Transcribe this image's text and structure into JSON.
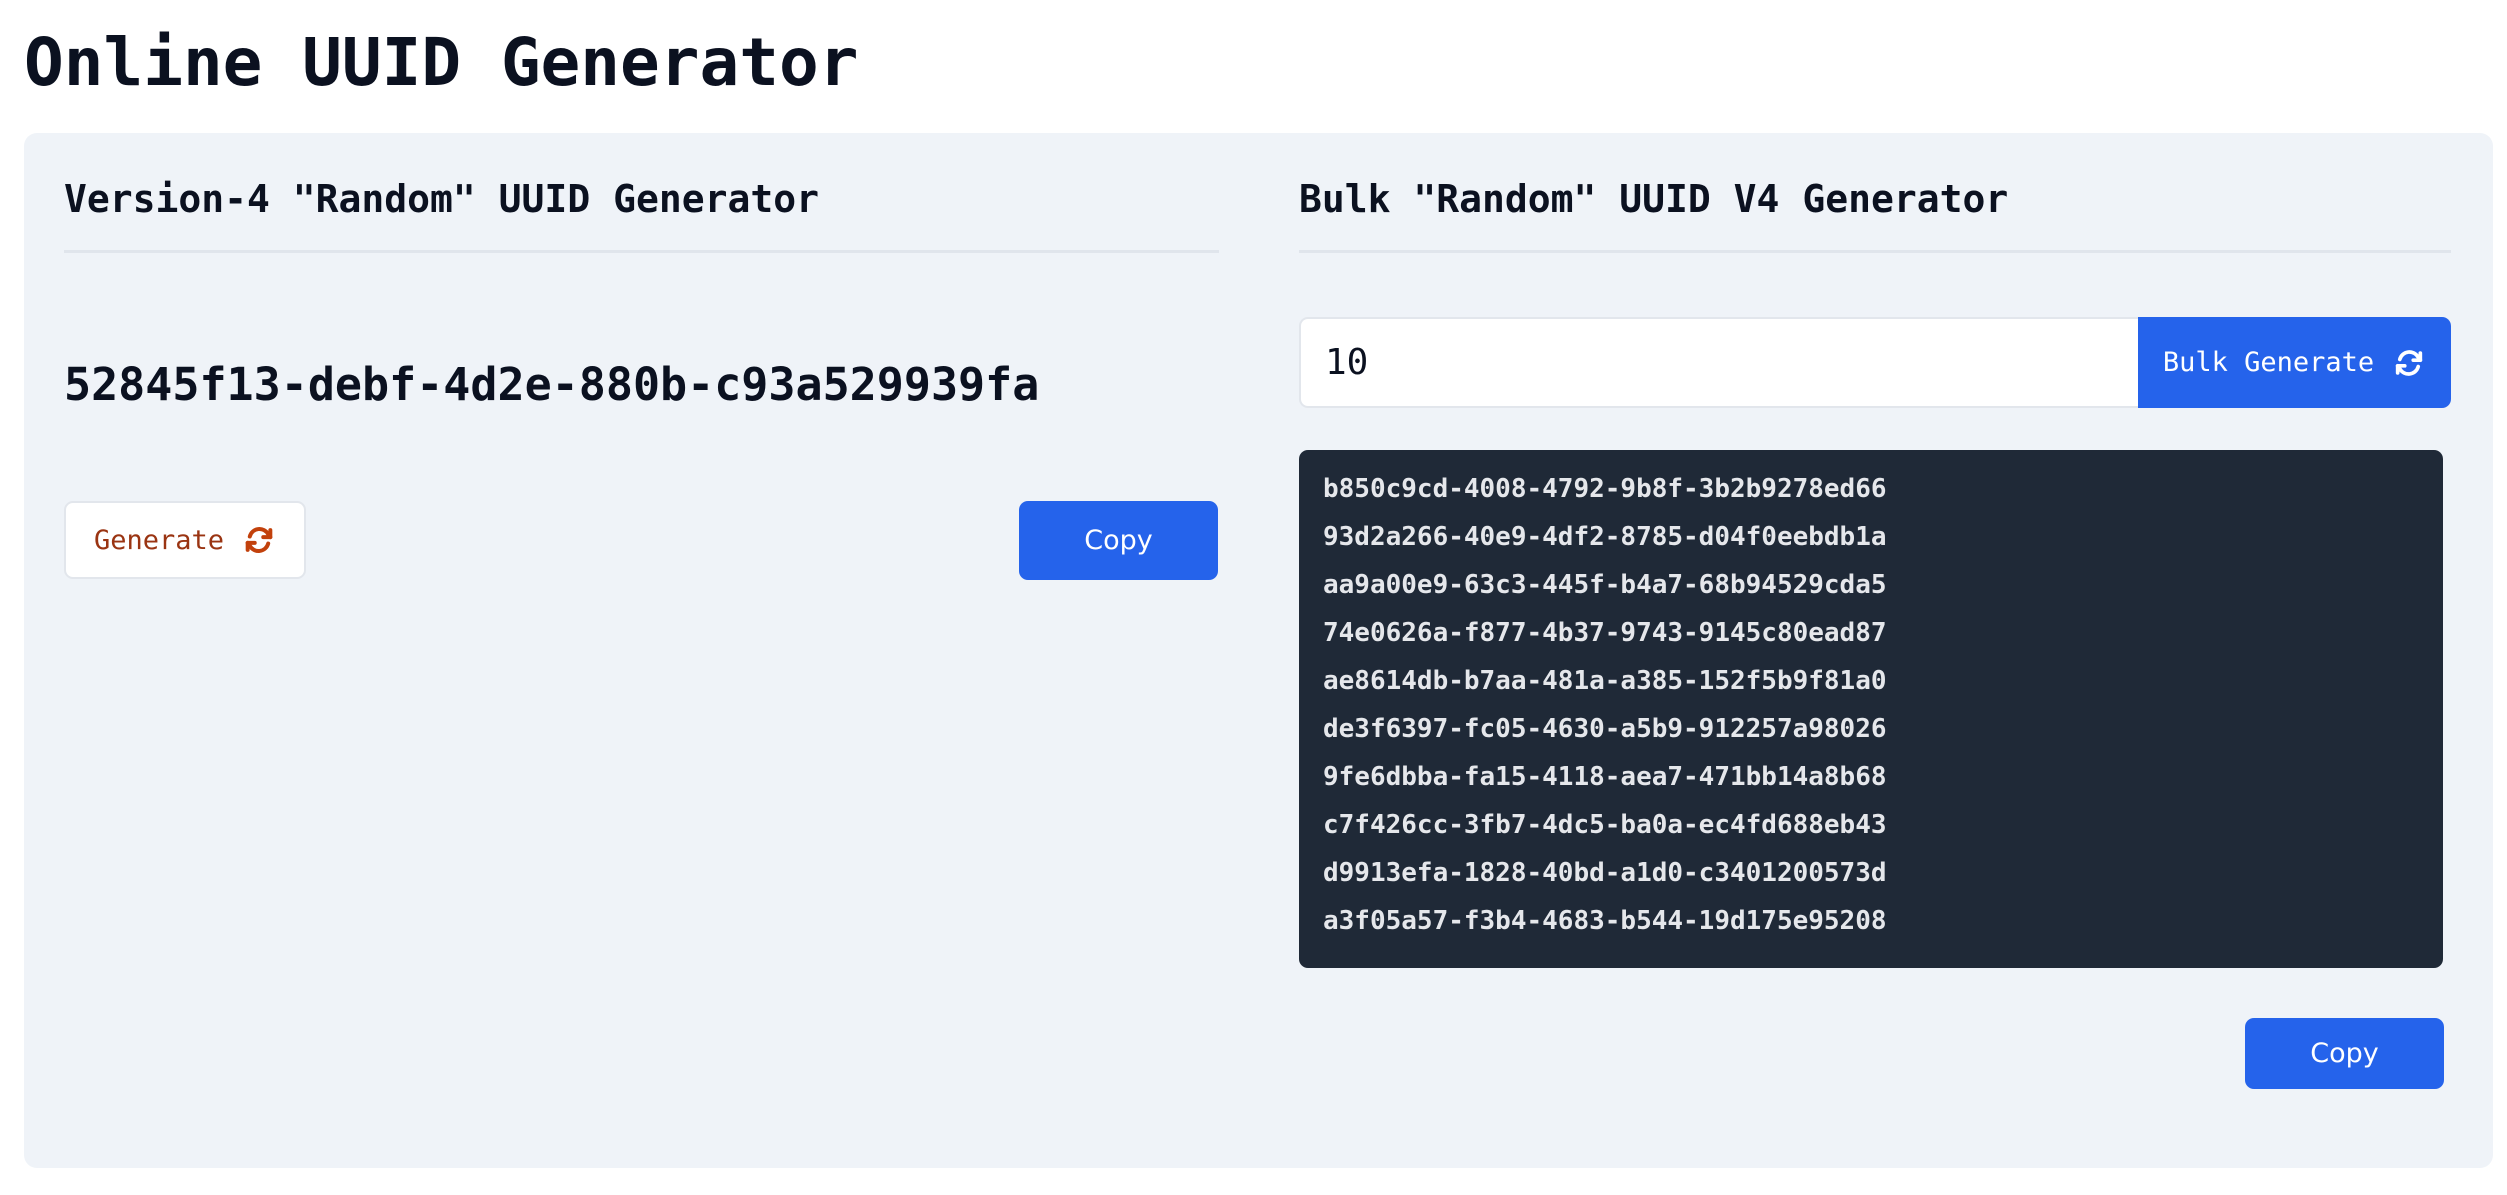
{
  "page": {
    "title": "Online UUID Generator"
  },
  "single": {
    "heading": "Version-4 \"Random\" UUID Generator",
    "uuid": "52845f13-debf-4d2e-880b-c93a529939fa",
    "generate_label": "Generate",
    "generate_icon": "refresh-icon",
    "copy_label": "Copy"
  },
  "bulk": {
    "heading": "Bulk \"Random\" UUID V4 Generator",
    "count_value": "10",
    "generate_label": "Bulk Generate",
    "generate_icon": "refresh-icon",
    "copy_label": "Copy",
    "uuids": [
      "b850c9cd-4008-4792-9b8f-3b2b9278ed66",
      "93d2a266-40e9-4df2-8785-d04f0eebdb1a",
      "aa9a00e9-63c3-445f-b4a7-68b94529cda5",
      "74e0626a-f877-4b37-9743-9145c80ead87",
      "ae8614db-b7aa-481a-a385-152f5b9f81a0",
      "de3f6397-fc05-4630-a5b9-912257a98026",
      "9fe6dbba-fa15-4118-aea7-471bb14a8b68",
      "c7f426cc-3fb7-4dc5-ba0a-ec4fd688eb43",
      "d9913efa-1828-40bd-a1d0-c3401200573d",
      "a3f05a57-f3b4-4683-b544-19d175e95208"
    ]
  },
  "colors": {
    "primary": "#2563eb",
    "generate_text": "#9a3412",
    "panel_bg": "#eff3f8",
    "list_bg": "#1f2937"
  }
}
